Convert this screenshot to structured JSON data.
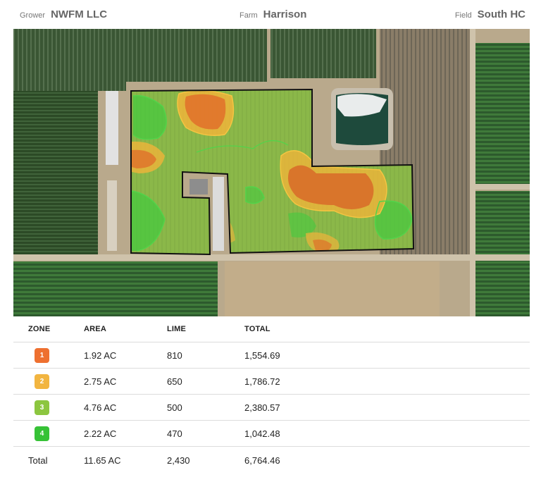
{
  "header": {
    "grower_label": "Grower",
    "grower_value": "NWFM LLC",
    "farm_label": "Farm",
    "farm_value": "Harrison",
    "field_label": "Field",
    "field_value": "South HC"
  },
  "map": {
    "basemap": "satellite imagery",
    "zone_colors": {
      "zone1": "#e8702a",
      "zone2": "#f0b43a",
      "zone3": "#8cc63f",
      "zone4": "#3ec43e"
    },
    "boundary_color": "#111111"
  },
  "table": {
    "headers": {
      "zone": "ZONE",
      "area": "AREA",
      "lime": "LIME",
      "total": "TOTAL"
    },
    "rows": [
      {
        "zone": "1",
        "color": "#ee7030",
        "area": "1.92 AC",
        "lime": "810",
        "total": "1,554.69"
      },
      {
        "zone": "2",
        "color": "#f2b540",
        "area": "2.75 AC",
        "lime": "650",
        "total": "1,786.72"
      },
      {
        "zone": "3",
        "color": "#8cc63f",
        "area": "4.76 AC",
        "lime": "500",
        "total": "2,380.57"
      },
      {
        "zone": "4",
        "color": "#36c236",
        "area": "2.22 AC",
        "lime": "470",
        "total": "1,042.48"
      }
    ],
    "footer": {
      "label": "Total",
      "area": "11.65 AC",
      "lime": "2,430",
      "total": "6,764.46"
    }
  }
}
